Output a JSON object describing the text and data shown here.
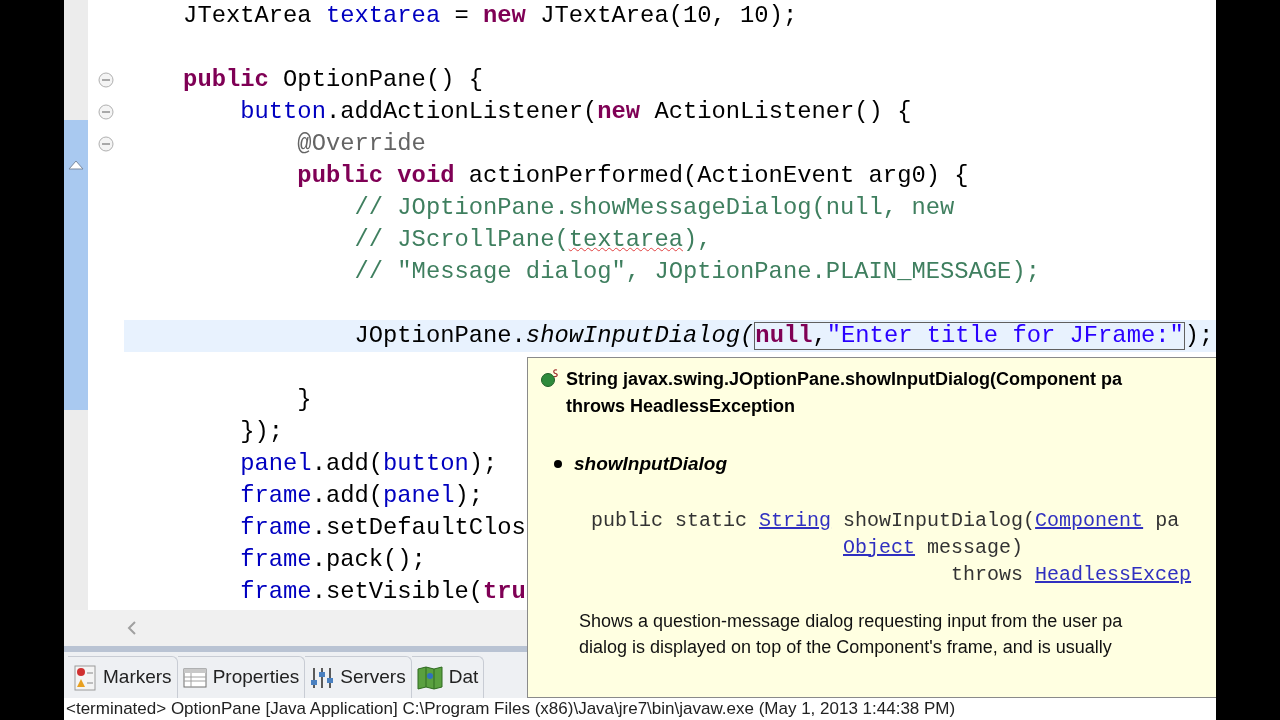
{
  "editor": {
    "lines": [
      {
        "kind": "code",
        "current": false,
        "fold_marker": false,
        "tokens": [
          {
            "kind": "plain",
            "text": "    JTextArea "
          },
          {
            "kind": "field",
            "text": "textarea"
          },
          {
            "kind": "plain",
            "text": " = "
          },
          {
            "kind": "keyword",
            "text": "new"
          },
          {
            "kind": "plain",
            "text": " JTextArea(10, 10);"
          }
        ]
      },
      {
        "kind": "blank",
        "current": false,
        "fold_marker": false
      },
      {
        "kind": "code",
        "current": false,
        "fold_marker": true,
        "tokens": [
          {
            "kind": "keyword",
            "text": "    public"
          },
          {
            "kind": "plain",
            "text": " OptionPane() {"
          }
        ]
      },
      {
        "kind": "code",
        "current": false,
        "fold_marker": true,
        "tokens": [
          {
            "kind": "field",
            "text": "        button"
          },
          {
            "kind": "plain",
            "text": ".addActionListener("
          },
          {
            "kind": "keyword",
            "text": "new"
          },
          {
            "kind": "plain",
            "text": " ActionListener() {"
          }
        ]
      },
      {
        "kind": "code",
        "current": false,
        "fold_marker": true,
        "tokens": [
          {
            "kind": "annotation",
            "text": "            @Override"
          }
        ]
      },
      {
        "kind": "code",
        "current": false,
        "fold_marker": false,
        "tokens": [
          {
            "kind": "keyword",
            "text": "            public void"
          },
          {
            "kind": "plain",
            "text": " actionPerformed(ActionEvent arg0) {"
          }
        ]
      },
      {
        "kind": "code",
        "current": false,
        "fold_marker": false,
        "tokens": [
          {
            "kind": "comment",
            "text": "                // JOptionPane.showMessageDialog(null, new"
          }
        ]
      },
      {
        "kind": "code",
        "current": false,
        "fold_marker": false,
        "tokens": [
          {
            "kind": "comment",
            "text": "                // JScrollPane("
          },
          {
            "kind": "comment",
            "text": "textarea",
            "flagged": true
          },
          {
            "kind": "comment",
            "text": "),"
          }
        ]
      },
      {
        "kind": "code",
        "current": false,
        "fold_marker": false,
        "tokens": [
          {
            "kind": "comment",
            "text": "                // \"Message dialog\", JOptionPane.PLAIN_MESSAGE);"
          }
        ]
      },
      {
        "kind": "blank",
        "current": false,
        "fold_marker": false
      },
      {
        "kind": "code",
        "current": true,
        "fold_marker": false,
        "tokens": [
          {
            "kind": "plain",
            "text": "                JOptionPane."
          },
          {
            "kind": "italic",
            "text": "showInputDialog("
          },
          {
            "kind": "keyword",
            "text": "null",
            "boxed": true
          },
          {
            "kind": "plain",
            "text": ",",
            "boxed": true
          },
          {
            "kind": "string",
            "text": "\"Enter title for JFrame:\"",
            "boxed": true
          },
          {
            "kind": "plain",
            "text": ");"
          }
        ]
      },
      {
        "kind": "blank",
        "current": false,
        "fold_marker": false
      },
      {
        "kind": "code",
        "current": false,
        "fold_marker": false,
        "tokens": [
          {
            "kind": "plain",
            "text": "            }"
          }
        ]
      },
      {
        "kind": "code",
        "current": false,
        "fold_marker": false,
        "tokens": [
          {
            "kind": "plain",
            "text": "        });"
          }
        ]
      },
      {
        "kind": "code",
        "current": false,
        "fold_marker": false,
        "tokens": [
          {
            "kind": "field",
            "text": "        panel"
          },
          {
            "kind": "plain",
            "text": ".add("
          },
          {
            "kind": "field",
            "text": "button"
          },
          {
            "kind": "plain",
            "text": ");"
          }
        ]
      },
      {
        "kind": "code",
        "current": false,
        "fold_marker": false,
        "tokens": [
          {
            "kind": "field",
            "text": "        frame"
          },
          {
            "kind": "plain",
            "text": ".add("
          },
          {
            "kind": "field",
            "text": "panel"
          },
          {
            "kind": "plain",
            "text": ");"
          }
        ]
      },
      {
        "kind": "code",
        "current": false,
        "fold_marker": false,
        "tokens": [
          {
            "kind": "field",
            "text": "        frame"
          },
          {
            "kind": "plain",
            "text": ".setDefaultClos"
          }
        ]
      },
      {
        "kind": "code",
        "current": false,
        "fold_marker": false,
        "tokens": [
          {
            "kind": "field",
            "text": "        frame"
          },
          {
            "kind": "plain",
            "text": ".pack();"
          }
        ]
      },
      {
        "kind": "code",
        "current": false,
        "fold_marker": false,
        "tokens": [
          {
            "kind": "field",
            "text": "        frame"
          },
          {
            "kind": "plain",
            "text": ".setVisible("
          },
          {
            "kind": "keyword",
            "text": "tru"
          }
        ]
      }
    ]
  },
  "hover_popup": {
    "header": [
      "String javax.swing.JOptionPane.showInputDialog(Component pa",
      "throws HeadlessException"
    ],
    "member": "showInputDialog",
    "signature": [
      [
        {
          "kind": "text",
          "text": "public static "
        },
        {
          "kind": "link",
          "text": "String"
        },
        {
          "kind": "text",
          "text": " showInputDialog("
        },
        {
          "kind": "link",
          "text": "Component"
        },
        {
          "kind": "text",
          "text": " pa"
        }
      ],
      [
        {
          "kind": "link",
          "text": "Object"
        },
        {
          "kind": "text",
          "text": " message)"
        }
      ],
      [
        {
          "kind": "text",
          "text": "         throws "
        },
        {
          "kind": "link",
          "text": "HeadlessExcep"
        }
      ]
    ],
    "description": [
      "Shows a question-message dialog requesting input from the user pa",
      "dialog is displayed on top of the Component's frame, and is usually"
    ]
  },
  "bottom_tabs": [
    {
      "kind": "markers",
      "label": "Markers"
    },
    {
      "kind": "properties",
      "label": "Properties"
    },
    {
      "kind": "servers",
      "label": "Servers"
    },
    {
      "kind": "data",
      "label": "Dat"
    }
  ],
  "status_bar": "<terminated> OptionPane [Java Application] C:\\Program Files (x86)\\Java\\jre7\\bin\\javaw.exe (May 1, 2013 1:44:38 PM)"
}
